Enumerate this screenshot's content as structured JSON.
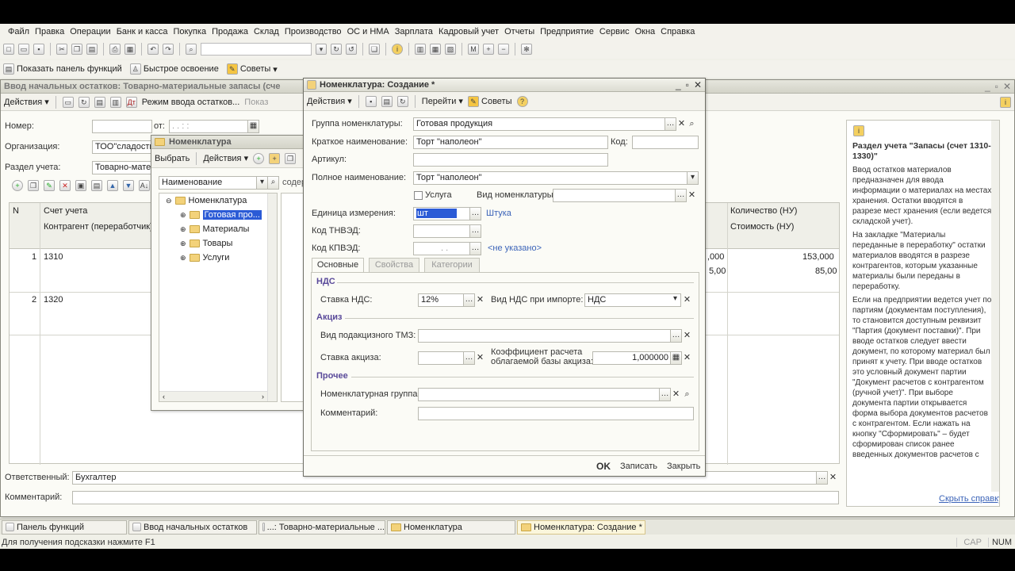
{
  "menu": [
    "Файл",
    "Правка",
    "Операции",
    "Банк и касса",
    "Покупка",
    "Продажа",
    "Склад",
    "Производство",
    "ОС и НМА",
    "Зарплата",
    "Кадровый учет",
    "Отчеты",
    "Предприятие",
    "Сервис",
    "Окна",
    "Справка"
  ],
  "toolbar2": {
    "panel": "Показать панель функций",
    "learn": "Быстрое освоение",
    "tips": "Советы"
  },
  "main_doc": {
    "title": "Ввод начальных остатков: Товарно-материальные запасы (сче",
    "actions": "Действия",
    "mode": "Режим ввода остатков...",
    "show": "Показ",
    "number_label": "Номер:",
    "from_label": "от:",
    "date_placeholder": ". .    : :",
    "org_label": "Организация:",
    "org_value": "ТОО\"сладость",
    "section_label": "Раздел учета:",
    "section_value": "Товарно-матер",
    "col_n": "N",
    "col_account": "Счет учета",
    "col_contractor": "Контрагент (переработчик)",
    "col_qty": "Количество (НУ)",
    "col_cost": "Стоимость (НУ)",
    "rows": [
      {
        "n": "1",
        "account": "1310",
        "qty_partial": ",000",
        "cost_partial": "5,00",
        "qty": "153,000",
        "cost": "85,00"
      },
      {
        "n": "2",
        "account": "1320"
      }
    ],
    "responsible_label": "Ответственный:",
    "responsible_value": "Бухгалтер",
    "comment_label": "Комментарий:"
  },
  "help": {
    "title": "Раздел учета \"Запасы (счет 1310-1330)\"",
    "paragraphs": [
      "Ввод остатков материалов предназначен для ввода информации о материалах на местах хранения. Остатки вводятся в разрезе мест хранения (если ведется складской учет).",
      "На закладке \"Материалы переданные в переработку\" остатки материалов вводятся в разрезе контрагентов, которым указанные материалы были переданы в переработку.",
      "Если на предприятии ведется учет по партиям (документам поступления), то становится доступным реквизит \"Партия (документ поставки)\". При вводе остатков следует ввести документ, по которому материал был принят к учету. При вводе остатков это условный документ партии \"Документ расчетов с контрагентом (ручной учет)\". При выборе документа партии открывается форма выбора документов расчетов с контрагентом. Если нажать на кнопку \"Сформировать\" – будет сформирован список ранее введенных документов расчетов с"
    ],
    "hide_link": "Скрыть справку"
  },
  "nomen_list": {
    "title": "Номенклатура",
    "select": "Выбрать",
    "actions": "Действия",
    "search_field": "Наименование",
    "cont_label": "содер",
    "tree": [
      {
        "label": "Номенклатура",
        "level": 0,
        "selected": false
      },
      {
        "label": "Готовая про...",
        "level": 1,
        "selected": true
      },
      {
        "label": "Материалы",
        "level": 1,
        "selected": false
      },
      {
        "label": "Товары",
        "level": 1,
        "selected": false
      },
      {
        "label": "Услуги",
        "level": 1,
        "selected": false
      }
    ]
  },
  "create": {
    "title": "Номенклатура: Создание *",
    "actions": "Действия",
    "goto": "Перейти",
    "tips": "Советы",
    "group_label": "Группа номенклатуры:",
    "group_value": "Готовая продукция",
    "short_label": "Краткое наименование:",
    "short_value": "Торт \"наполеон\"",
    "code_label": "Код:",
    "code_value": "",
    "article_label": "Артикул:",
    "article_value": "",
    "full_label": "Полное наименование:",
    "full_value": "Торт \"наполеон\"",
    "service_label": "Услуга",
    "service_checked": false,
    "kind_label": "Вид номенклатуры:",
    "kind_value": "",
    "unit_label": "Единица измерения:",
    "unit_value": "шт",
    "unit_link": "Штука",
    "tnved_label": "Код ТНВЭД:",
    "kpved_label": "Код КПВЭД:",
    "kpved_placeholder": ". .",
    "kpved_link": "<не указано>",
    "tabs": [
      {
        "label": "Основные",
        "active": true
      },
      {
        "label": "Свойства",
        "active": false
      },
      {
        "label": "Категории",
        "active": false
      }
    ],
    "vat_section": "НДС",
    "vat_rate_label": "Ставка НДС:",
    "vat_rate_value": "12%",
    "vat_import_label": "Вид НДС при импорте:",
    "vat_import_value": "НДС",
    "excise_section": "Акциз",
    "excise_item_label": "Вид подакцизного ТМЗ:",
    "excise_item_value": "",
    "excise_rate_label": "Ставка акциза:",
    "excise_coef_label": "Коэффициент расчета облагаемой базы акциза:",
    "excise_coef_value": "1,000000",
    "other_section": "Прочее",
    "nom_group_label": "Номенклатурная группа:",
    "nom_group_value": "",
    "comment_label": "Комментарий:",
    "comment_value": "",
    "ok": "OK",
    "save": "Записать",
    "close": "Закрыть"
  },
  "taskbar": [
    {
      "label": "Панель функций",
      "active": false
    },
    {
      "label": "Ввод начальных остатков",
      "active": false
    },
    {
      "label": "...: Товарно-материальные ...",
      "active": false
    },
    {
      "label": "Номенклатура",
      "active": false
    },
    {
      "label": "Номенклатура: Создание *",
      "active": true
    }
  ],
  "status": {
    "hint": "Для получения подсказки нажмите F1",
    "cap": "CAP",
    "num": "NUM"
  }
}
